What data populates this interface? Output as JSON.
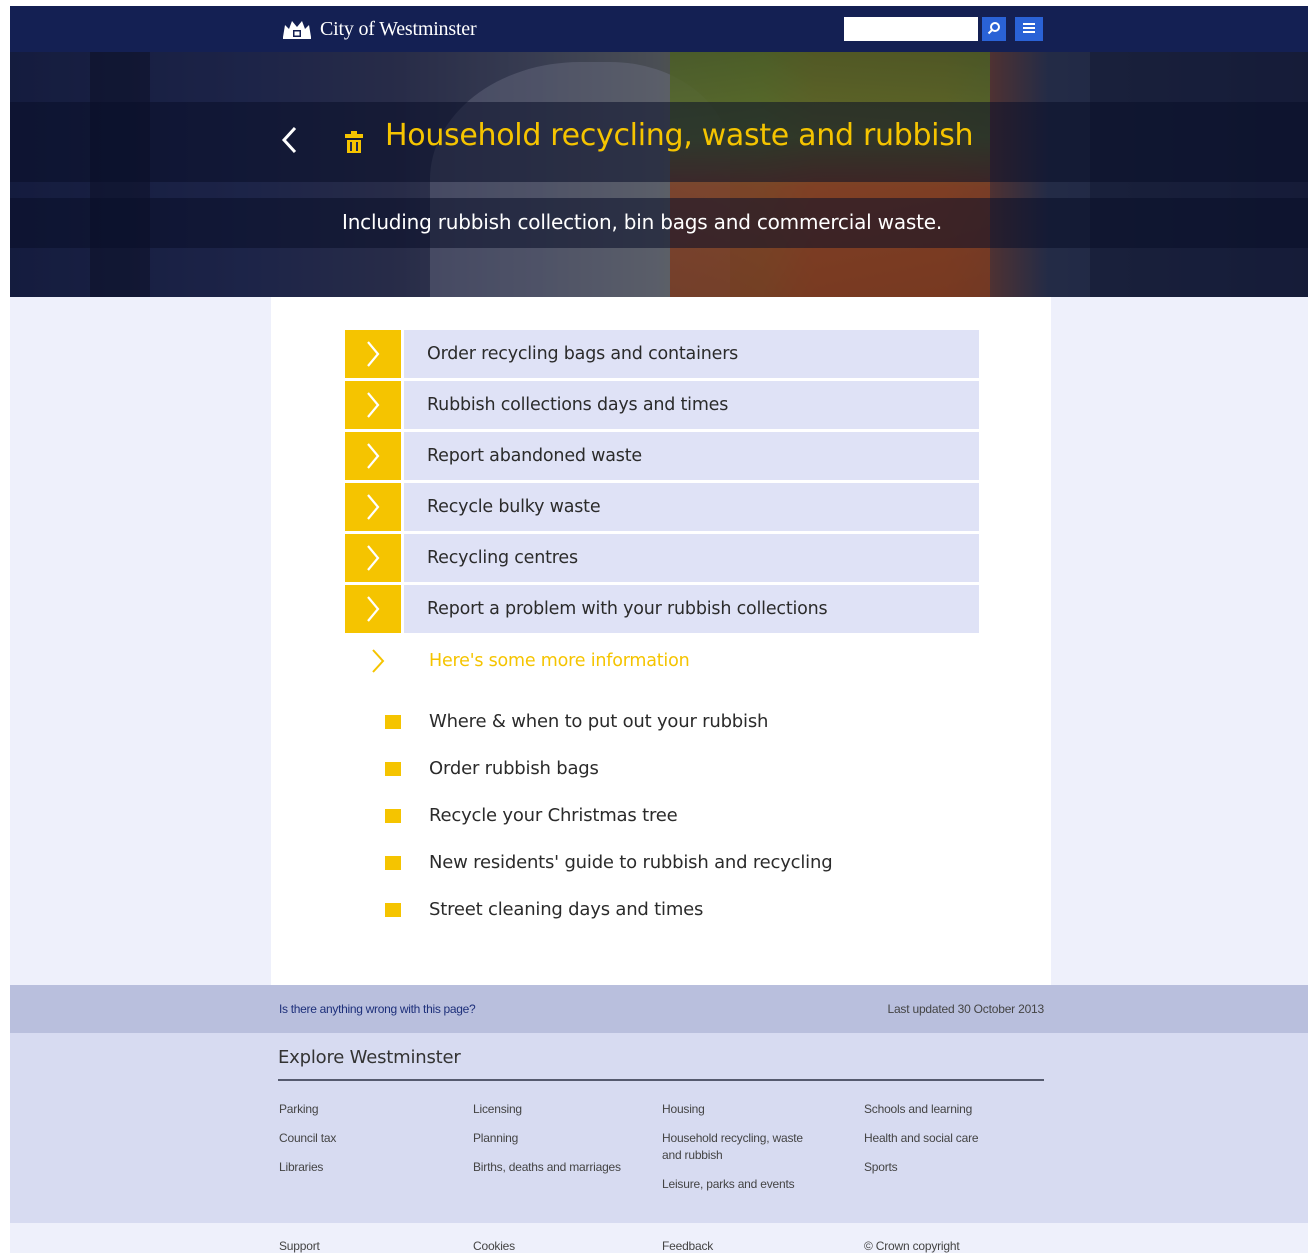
{
  "header": {
    "brand_name": "City of Westminster",
    "search_placeholder": "",
    "colors": {
      "bar": "#142053",
      "button": "#2a62d6"
    },
    "icons": [
      "crest-icon",
      "search-icon",
      "menu-icon"
    ]
  },
  "hero": {
    "title": "Household recycling, waste and rubbish",
    "subtitle": "Including rubbish collection, bin bags and commercial waste.",
    "icons": [
      "back-chevron-icon",
      "bin-icon"
    ],
    "accent_color": "#f5c400"
  },
  "tasks": [
    {
      "label": "Order recycling bags and containers"
    },
    {
      "label": "Rubbish collections days and times"
    },
    {
      "label": "Report abandoned waste"
    },
    {
      "label": "Recycle bulky waste"
    },
    {
      "label": "Recycling centres"
    },
    {
      "label": "Report a problem with your rubbish collections"
    }
  ],
  "more_info": {
    "label": "Here's some more information",
    "links": [
      {
        "label": "Where & when to put out your rubbish"
      },
      {
        "label": "Order rubbish bags"
      },
      {
        "label": "Recycle your Christmas tree"
      },
      {
        "label": "New residents' guide to rubbish and recycling"
      },
      {
        "label": "Street cleaning days and times"
      }
    ]
  },
  "feedback": {
    "wrong_link": "Is there anything wrong with this page?",
    "last_updated": "Last updated  30 October 2013"
  },
  "explore": {
    "title": "Explore Westminster",
    "columns": [
      [
        "Parking",
        "Council tax",
        "Libraries"
      ],
      [
        "Licensing",
        "Planning",
        "Births, deaths and marriages"
      ],
      [
        "Housing",
        "Household recycling, waste and rubbish",
        "Leisure, parks and events"
      ],
      [
        "Schools and learning",
        "Health and social care",
        "Sports"
      ]
    ]
  },
  "footer": {
    "links": [
      "Support",
      "Cookies",
      "Feedback",
      "© Crown copyright"
    ]
  }
}
